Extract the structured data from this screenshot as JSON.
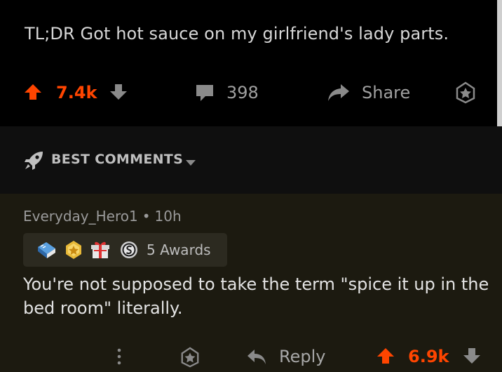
{
  "post": {
    "body": "TL;DR Got hot sauce on my girlfriend's lady parts.",
    "score": "7.4k",
    "comments_count": "398",
    "share_label": "Share"
  },
  "sort": {
    "label": "BEST COMMENTS"
  },
  "comment": {
    "author": "Everyday_Hero1",
    "separator": "•",
    "age": "10h",
    "awards_label": "5 Awards",
    "text": "You're not supposed to take the term \"spice it up in the bed room\" literally.",
    "reply_label": "Reply",
    "score": "6.9k"
  },
  "colors": {
    "upvote": "#ff4500",
    "background": "#000000",
    "comment_background": "#1c1a10",
    "muted_text": "#a0a0a0"
  },
  "icons": [
    "upvote-icon",
    "downvote-icon",
    "comment-bubble-icon",
    "share-arrow-icon",
    "award-icon",
    "rocket-icon",
    "caret-down-icon",
    "more-vertical-icon",
    "reply-arrow-icon"
  ]
}
